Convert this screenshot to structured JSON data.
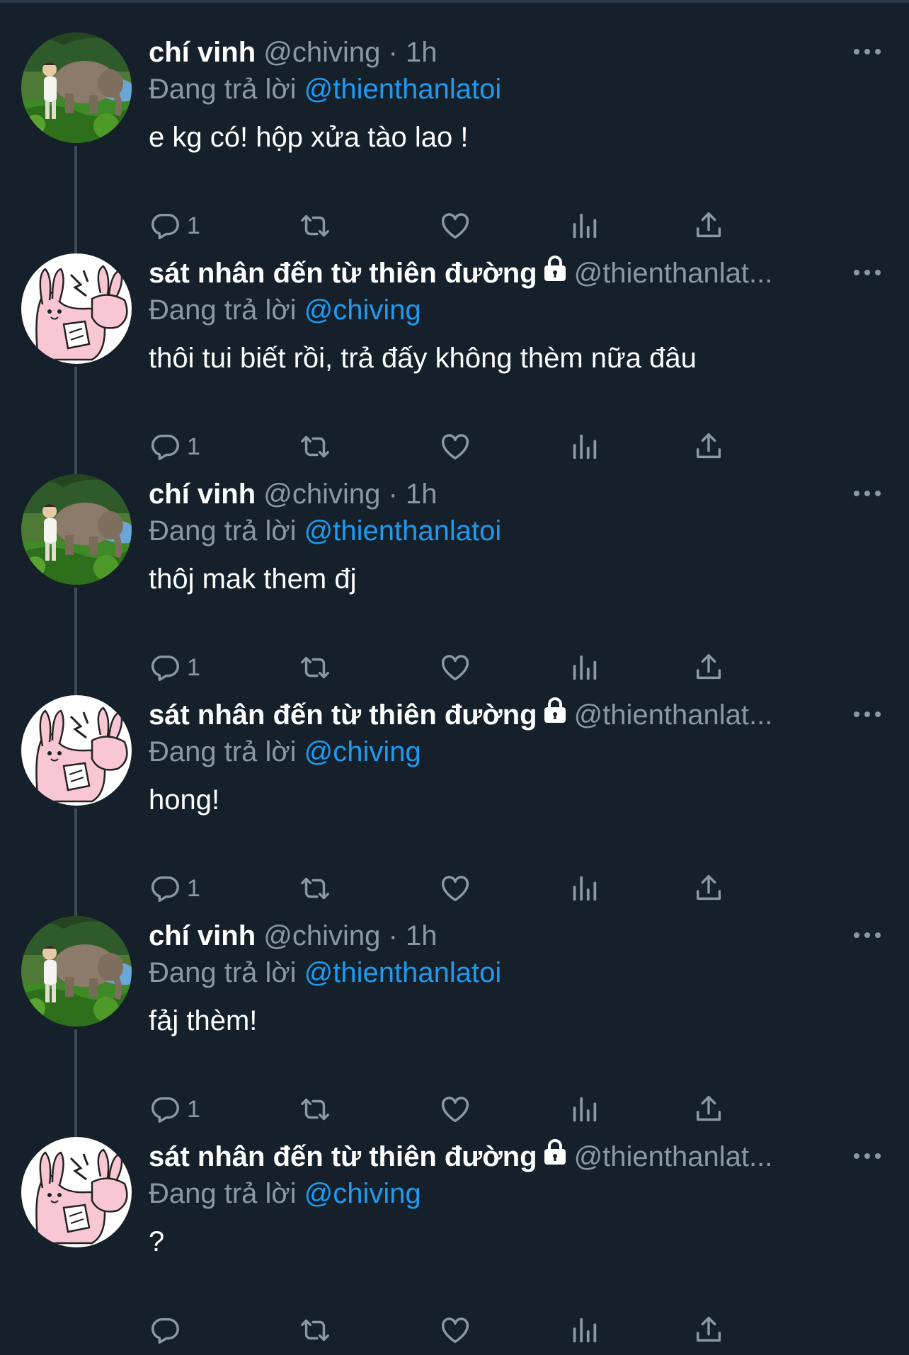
{
  "tweets": [
    {
      "author": "chí vinh",
      "handle": "@chiving",
      "dot": "·",
      "time": "1h",
      "locked": false,
      "avatar_icon": "elephant-photo",
      "reply_prefix": "Đang trả lời",
      "reply_to": "@thienthanlatoi",
      "text": "e kg có! hộp xửa tào lao !",
      "reply_count": "1"
    },
    {
      "author": "sát nhân đến từ thiên đường",
      "handle": "@thienthanlat...",
      "dot": "",
      "time": "",
      "locked": true,
      "avatar_icon": "bunny-sticker",
      "reply_prefix": "Đang trả lời",
      "reply_to": "@chiving",
      "text": "thôi tui biết rồi, trả đấy không thèm nữa đâu",
      "reply_count": "1"
    },
    {
      "author": "chí vinh",
      "handle": "@chiving",
      "dot": "·",
      "time": "1h",
      "locked": false,
      "avatar_icon": "elephant-photo",
      "reply_prefix": "Đang trả lời",
      "reply_to": "@thienthanlatoi",
      "text": "thôj mak them đj",
      "reply_count": "1"
    },
    {
      "author": "sát nhân đến từ thiên đường",
      "handle": "@thienthanlat...",
      "dot": "",
      "time": "",
      "locked": true,
      "avatar_icon": "bunny-sticker",
      "reply_prefix": "Đang trả lời",
      "reply_to": "@chiving",
      "text": "hong!",
      "reply_count": "1"
    },
    {
      "author": "chí vinh",
      "handle": "@chiving",
      "dot": "·",
      "time": "1h",
      "locked": false,
      "avatar_icon": "elephant-photo",
      "reply_prefix": "Đang trả lời",
      "reply_to": "@thienthanlatoi",
      "text": "fảj thèm!",
      "reply_count": "1"
    },
    {
      "author": "sát nhân đến từ thiên đường",
      "handle": "@thienthanlat...",
      "dot": "",
      "time": "",
      "locked": true,
      "avatar_icon": "bunny-sticker",
      "reply_prefix": "Đang trả lời",
      "reply_to": "@chiving",
      "text": "?",
      "reply_count": ""
    }
  ],
  "colors": {
    "background": "#15202b",
    "text": "#ffffff",
    "muted": "#8b98a5",
    "link": "#1d9bf0",
    "thread_line": "#3d4a57"
  },
  "icons": [
    "reply-icon",
    "retweet-icon",
    "like-icon",
    "views-icon",
    "share-icon",
    "more-icon",
    "lock-icon"
  ]
}
